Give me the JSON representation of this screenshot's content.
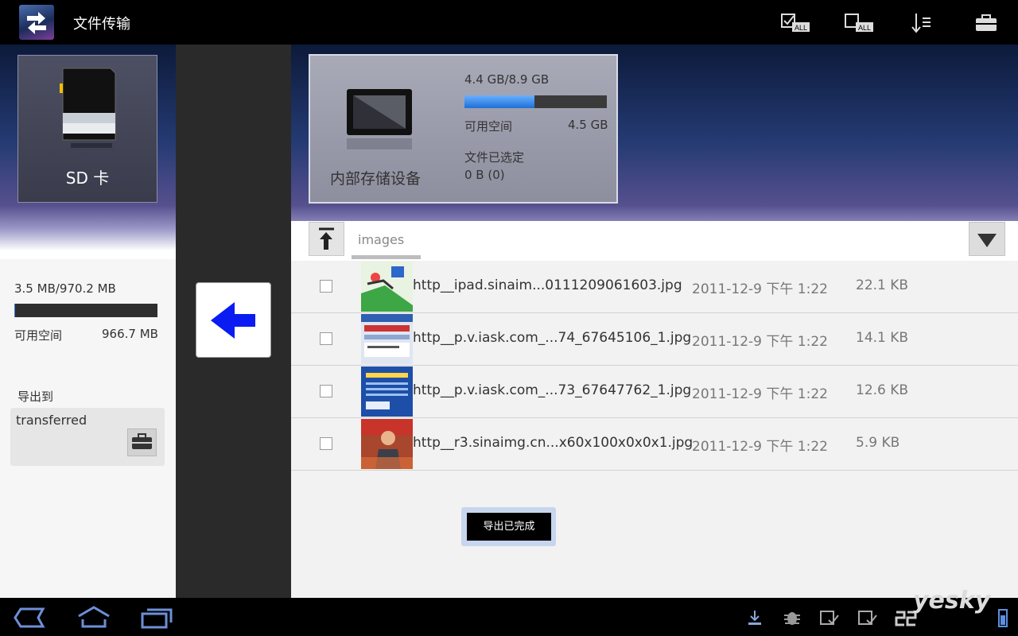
{
  "app": {
    "title": "文件传输"
  },
  "sd_card": {
    "label": "SD 卡"
  },
  "sd_stats": {
    "used_total": "3.5 MB/970.2 MB",
    "free_label": "可用空间",
    "free_value": "966.7 MB",
    "usage_fraction": 0.004
  },
  "export": {
    "label": "导出到",
    "destination": "transferred"
  },
  "internal": {
    "name": "内部存储设备",
    "used_total": "4.4 GB/8.9 GB",
    "usage_fraction": 0.49,
    "free_label": "可用空间",
    "free_value": "4.5 GB",
    "selected_label": "文件已选定",
    "selected_value": "0 B (0)"
  },
  "path": {
    "folder": "images"
  },
  "files": [
    {
      "name": "http__ipad.sinaim...0111209061603.jpg",
      "date": "2011-12-9 下午 1:22",
      "size": "22.1 KB"
    },
    {
      "name": "http__p.v.iask.com_...74_67645106_1.jpg",
      "date": "2011-12-9 下午 1:22",
      "size": "14.1 KB"
    },
    {
      "name": "http__p.v.iask.com_...73_67647762_1.jpg",
      "date": "2011-12-9 下午 1:22",
      "size": "12.6 KB"
    },
    {
      "name": "http__r3.sinaimg.cn...x60x100x0x0x1.jpg",
      "date": "2011-12-9 下午 1:22",
      "size": "5.9 KB"
    }
  ],
  "toast": {
    "text": "导出已完成"
  },
  "watermark": {
    "text": "yesky"
  }
}
